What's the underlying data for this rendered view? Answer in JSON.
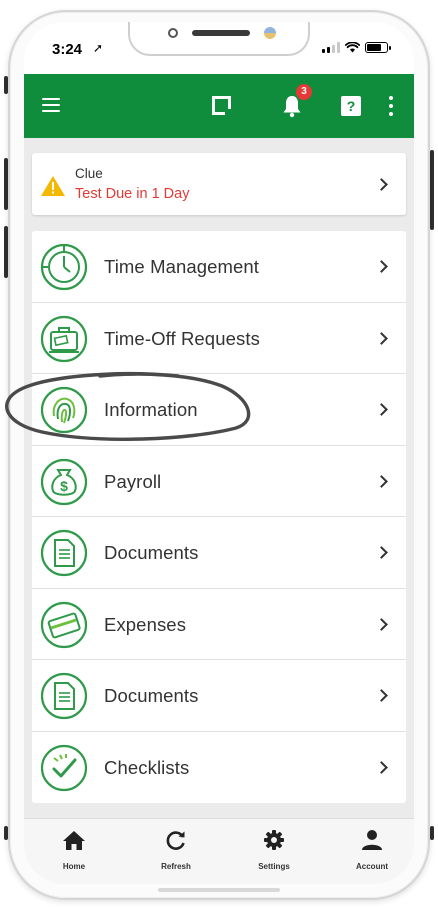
{
  "status_bar": {
    "time": "3:24",
    "location_arrow": "➚"
  },
  "header": {
    "menu_icon": "hamburger-icon",
    "logo_icon": "app-logo-icon",
    "notification_icon": "bell-icon",
    "notification_count": "3",
    "help_icon": "help-icon",
    "help_label": "?",
    "more_icon": "more-vertical-icon"
  },
  "alert": {
    "icon": "warning-icon",
    "title": "Clue",
    "message": "Test Due in 1 Day",
    "message_color": "#e53935",
    "icon_color": "#f5b800"
  },
  "menu": {
    "items": [
      {
        "label": "Time Management",
        "icon": "clock-icon"
      },
      {
        "label": "Time-Off Requests",
        "icon": "suitcase-icon"
      },
      {
        "label": "Information",
        "icon": "fingerprint-icon"
      },
      {
        "label": "Payroll",
        "icon": "money-bag-icon"
      },
      {
        "label": "Documents",
        "icon": "document-icon"
      },
      {
        "label": "Expenses",
        "icon": "credit-card-icon"
      },
      {
        "label": "Documents",
        "icon": "document-icon"
      },
      {
        "label": "Checklists",
        "icon": "checklist-icon"
      }
    ]
  },
  "bottom_nav": {
    "items": [
      {
        "label": "Home",
        "icon": "home-icon"
      },
      {
        "label": "Refresh",
        "icon": "refresh-icon"
      },
      {
        "label": "Settings",
        "icon": "gear-icon"
      },
      {
        "label": "Account",
        "icon": "account-icon"
      }
    ]
  },
  "colors": {
    "brand_green": "#0f8c3c",
    "icon_green": "#2e9a4a",
    "badge_red": "#e53935",
    "content_bg": "#ebebeb"
  },
  "annotation": {
    "type": "hand-drawn-ellipse",
    "target": "Information"
  }
}
